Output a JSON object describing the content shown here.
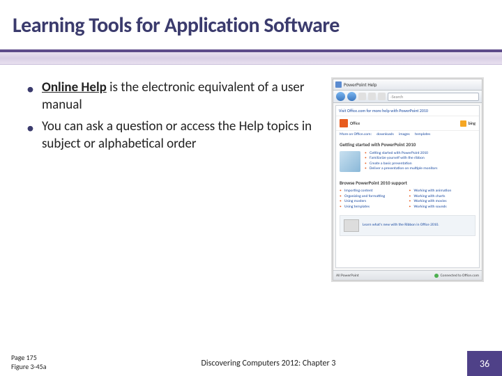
{
  "title": "Learning Tools for Application Software",
  "bullets": [
    {
      "term": "Online Help",
      "rest": " is the electronic equivalent of a user manual"
    },
    {
      "term": "",
      "rest": "You can ask a question or access the Help topics in subject or alphabetical order"
    }
  ],
  "help_window": {
    "title": "PowerPoint Help",
    "search_placeholder": "Search",
    "top_link": "Visit Office.com for more help with PowerPoint 2010",
    "office_label": "Office",
    "bing_label": "bing",
    "subnav": [
      "More on Office.com:",
      "downloads",
      "images",
      "templates"
    ],
    "section1_title": "Getting started with PowerPoint 2010",
    "section1_items": [
      "Getting started with PowerPoint 2010",
      "Familiarize yourself with the ribbon",
      "Create a basic presentation",
      "Deliver a presentation on multiple monitors"
    ],
    "section2_title": "Browse PowerPoint 2010 support",
    "section2_col1": [
      "Importing content",
      "Organizing and formatting",
      "Using masters",
      "Using templates"
    ],
    "section2_col2": [
      "Working with animation",
      "Working with charts",
      "Working with movies",
      "Working with sounds"
    ],
    "ribbon_box": "Learn what's new with the Ribbon in Office 2010.",
    "status_left": "All PowerPoint",
    "status_right": "Connected to Office.com"
  },
  "footer": {
    "page_ref": "Page 175",
    "figure_ref": "Figure 3-45a",
    "center": "Discovering Computers 2012: Chapter 3",
    "slide_number": "36"
  }
}
